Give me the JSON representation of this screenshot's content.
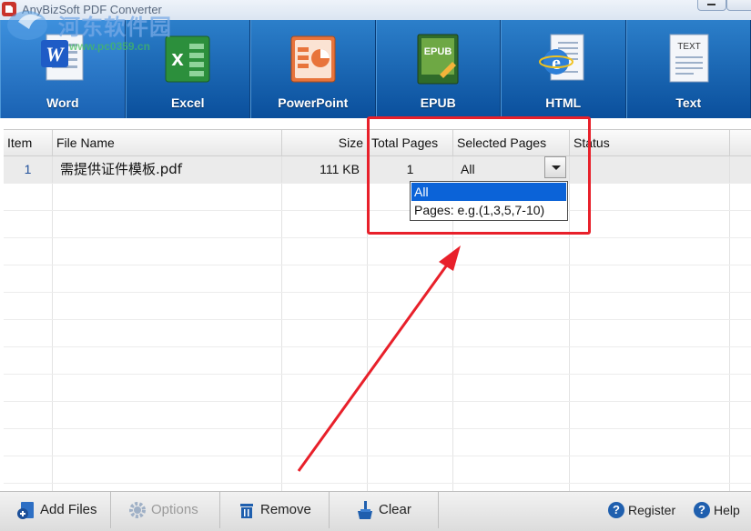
{
  "window": {
    "title": "AnyBizSoft PDF Converter",
    "watermark_name": "河东软件园",
    "watermark_url": "www.pc0359.cn"
  },
  "formats": [
    {
      "label": "Word",
      "selected": true
    },
    {
      "label": "Excel",
      "selected": false
    },
    {
      "label": "PowerPoint",
      "selected": false
    },
    {
      "label": "EPUB",
      "selected": false
    },
    {
      "label": "HTML",
      "selected": false
    },
    {
      "label": "Text",
      "selected": false
    }
  ],
  "icons": {
    "word": "word-icon",
    "excel": "excel-icon",
    "powerpoint": "powerpoint-icon",
    "epub": "epub-icon",
    "html": "html-icon",
    "text": "text-icon",
    "epub_text": "EPUB",
    "text_text": "TEXT"
  },
  "table": {
    "columns": [
      "Item",
      "File Name",
      "Size",
      "Total Pages",
      "Selected Pages",
      "Status"
    ],
    "rows": [
      {
        "item": "1",
        "file_name": "需提供证件模板.pdf",
        "size": "111  KB",
        "total_pages": "1",
        "selected_pages": "All",
        "status": ""
      }
    ]
  },
  "dropdown": {
    "options": [
      "All",
      "Pages: e.g.(1,3,5,7-10)"
    ],
    "selected_index": 0
  },
  "bottom": {
    "add_files": "Add Files",
    "options": "Options",
    "remove": "Remove",
    "clear": "Clear",
    "register": "Register",
    "help": "Help"
  },
  "colors": {
    "toolbar_blue": "#0a4f9c",
    "selection_blue": "#0b63d8",
    "annotation_red": "#e8202a"
  }
}
